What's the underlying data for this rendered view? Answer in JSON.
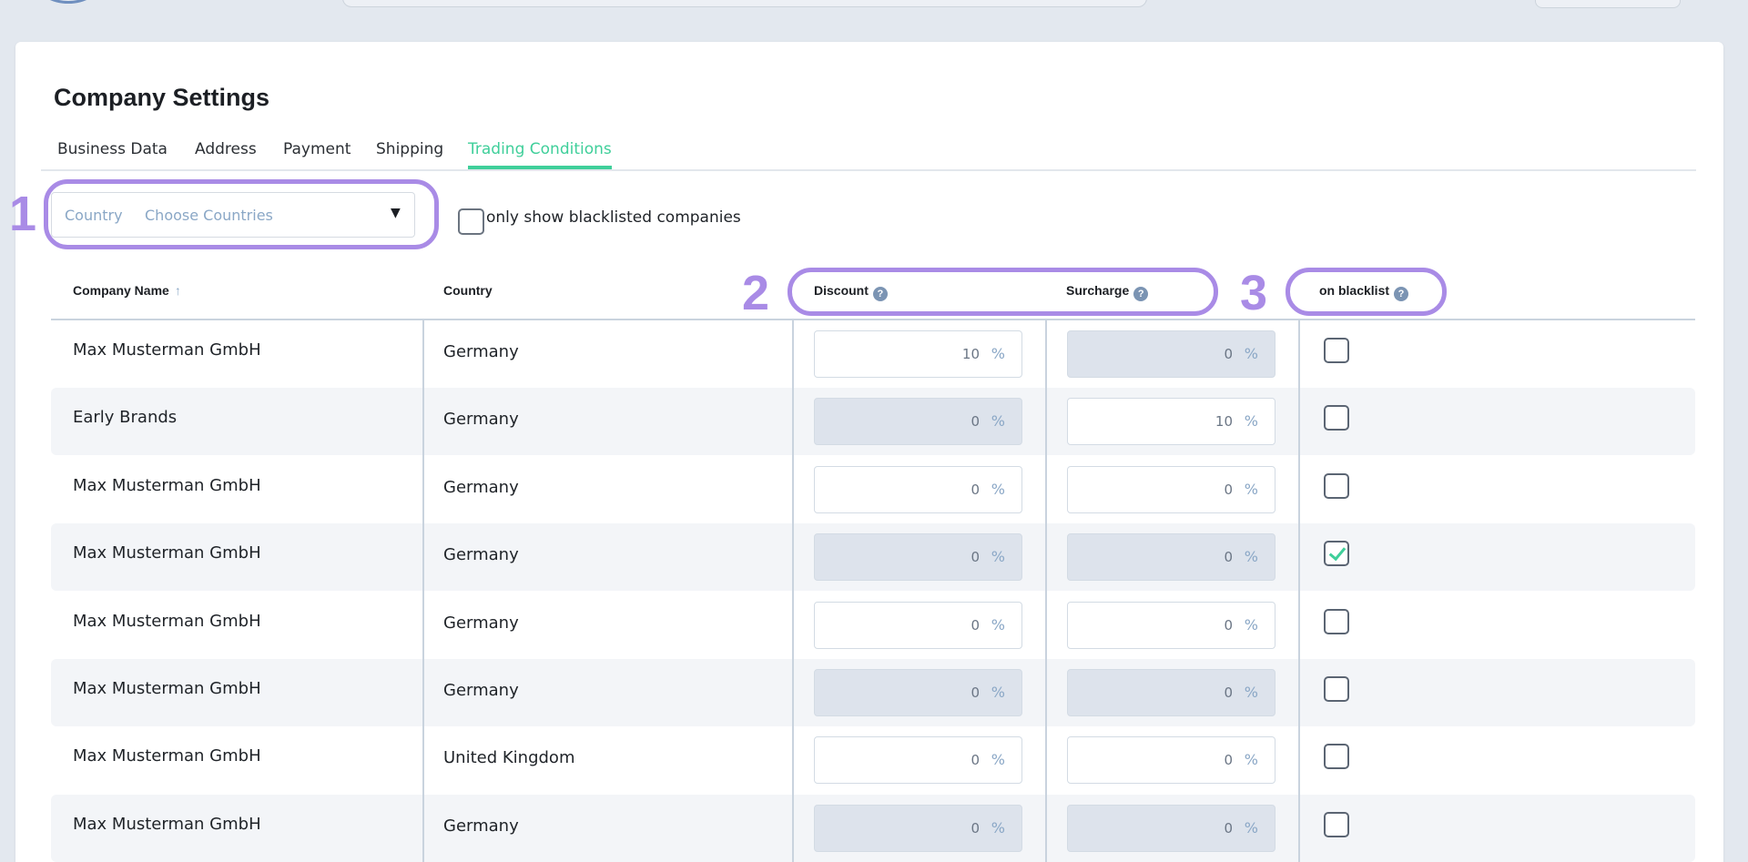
{
  "page": {
    "title": "Company Settings"
  },
  "tabs": [
    {
      "label": "Business Data",
      "active": false
    },
    {
      "label": "Address",
      "active": false
    },
    {
      "label": "Payment",
      "active": false
    },
    {
      "label": "Shipping",
      "active": false
    },
    {
      "label": "Trading Conditions",
      "active": true
    }
  ],
  "filters": {
    "country_label": "Country",
    "country_value": "Choose Countries",
    "blacklist_only_label": "only show blacklisted companies",
    "blacklist_only_checked": false
  },
  "table": {
    "columns": {
      "company_name": "Company Name",
      "country": "Country",
      "discount": "Discount",
      "surcharge": "Surcharge",
      "on_blacklist": "on blacklist"
    },
    "sort_icon": "arrow-up-icon",
    "help_icon": "help-icon",
    "rows": [
      {
        "company": "Max Musterman GmbH",
        "country": "Germany",
        "discount": "10",
        "surcharge": "0",
        "blacklisted": false
      },
      {
        "company": "Early Brands",
        "country": "Germany",
        "discount": "0",
        "surcharge": "10",
        "blacklisted": false
      },
      {
        "company": "Max Musterman GmbH",
        "country": "Germany",
        "discount": "0",
        "surcharge": "0",
        "blacklisted": false
      },
      {
        "company": "Max Musterman GmbH",
        "country": "Germany",
        "discount": "0",
        "surcharge": "0",
        "blacklisted": true
      },
      {
        "company": "Max Musterman GmbH",
        "country": "Germany",
        "discount": "0",
        "surcharge": "0",
        "blacklisted": false
      },
      {
        "company": "Max Musterman GmbH",
        "country": "Germany",
        "discount": "0",
        "surcharge": "0",
        "blacklisted": false
      },
      {
        "company": "Max Musterman GmbH",
        "country": "United Kingdom",
        "discount": "0",
        "surcharge": "0",
        "blacklisted": false
      },
      {
        "company": "Max Musterman GmbH",
        "country": "Germany",
        "discount": "0",
        "surcharge": "0",
        "blacklisted": false
      }
    ],
    "percent_unit": "%"
  },
  "annotations": {
    "marker_1": "1",
    "marker_2": "2",
    "marker_3": "3",
    "color": "#a98be6"
  },
  "colors": {
    "accent": "#3fcf9a",
    "shaded_input": "#dde3ec",
    "alt_row": "#f3f5f8"
  }
}
